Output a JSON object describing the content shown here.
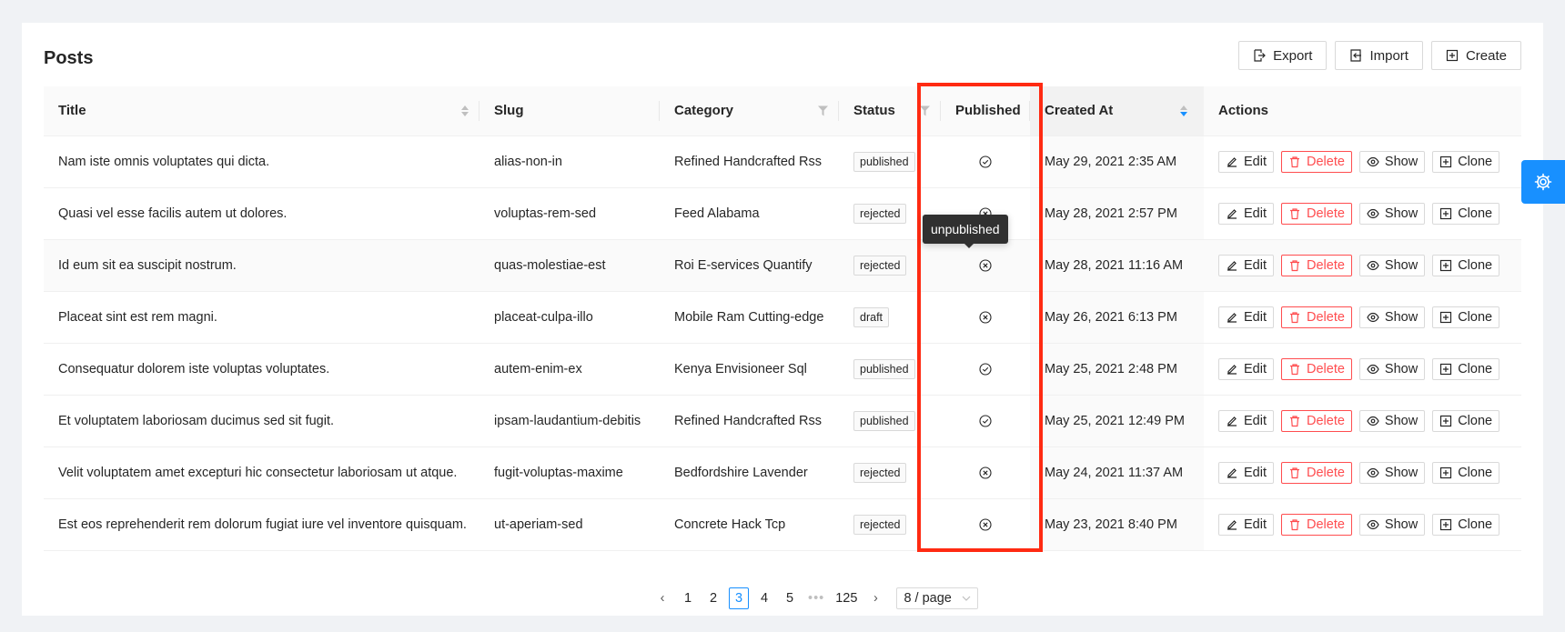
{
  "page": {
    "title": "Posts"
  },
  "toolbar": {
    "export_label": "Export",
    "import_label": "Import",
    "create_label": "Create"
  },
  "columns": {
    "title": "Title",
    "slug": "Slug",
    "category": "Category",
    "status": "Status",
    "published": "Published",
    "created_at": "Created At",
    "actions": "Actions"
  },
  "rows": [
    {
      "title": "Nam iste omnis voluptates qui dicta.",
      "slug": "alias-non-in",
      "category": "Refined Handcrafted Rss",
      "status": "published",
      "published": true,
      "created_at": "May 29, 2021 2:35 AM"
    },
    {
      "title": "Quasi vel esse facilis autem ut dolores.",
      "slug": "voluptas-rem-sed",
      "category": "Feed Alabama",
      "status": "rejected",
      "published": false,
      "created_at": "May 28, 2021 2:57 PM"
    },
    {
      "title": "Id eum sit ea suscipit nostrum.",
      "slug": "quas-molestiae-est",
      "category": "Roi E-services Quantify",
      "status": "rejected",
      "published": false,
      "created_at": "May 28, 2021 11:16 AM"
    },
    {
      "title": "Placeat sint est rem magni.",
      "slug": "placeat-culpa-illo",
      "category": "Mobile Ram Cutting-edge",
      "status": "draft",
      "published": false,
      "created_at": "May 26, 2021 6:13 PM"
    },
    {
      "title": "Consequatur dolorem iste voluptas voluptates.",
      "slug": "autem-enim-ex",
      "category": "Kenya Envisioneer Sql",
      "status": "published",
      "published": true,
      "created_at": "May 25, 2021 2:48 PM"
    },
    {
      "title": "Et voluptatem laboriosam ducimus sed sit fugit.",
      "slug": "ipsam-laudantium-debitis",
      "category": "Refined Handcrafted Rss",
      "status": "published",
      "published": true,
      "created_at": "May 25, 2021 12:49 PM"
    },
    {
      "title": "Velit voluptatem amet excepturi hic consectetur laboriosam ut atque.",
      "slug": "fugit-voluptas-maxime",
      "category": "Bedfordshire Lavender",
      "status": "rejected",
      "published": false,
      "created_at": "May 24, 2021 11:37 AM"
    },
    {
      "title": "Est eos reprehenderit rem dolorum fugiat iure vel inventore quisquam.",
      "slug": "ut-aperiam-sed",
      "category": "Concrete Hack Tcp",
      "status": "rejected",
      "published": false,
      "created_at": "May 23, 2021 8:40 PM"
    }
  ],
  "row_actions": {
    "edit": "Edit",
    "delete": "Delete",
    "show": "Show",
    "clone": "Clone"
  },
  "tooltip": {
    "text": "unpublished"
  },
  "pagination": {
    "pages": [
      "1",
      "2",
      "3",
      "4",
      "5"
    ],
    "current": "3",
    "ellipsis": "•••",
    "last": "125",
    "page_size": "8 / page"
  },
  "colors": {
    "accent": "#1890ff",
    "danger": "#ff4d4f",
    "highlight": "#ff2a12"
  }
}
